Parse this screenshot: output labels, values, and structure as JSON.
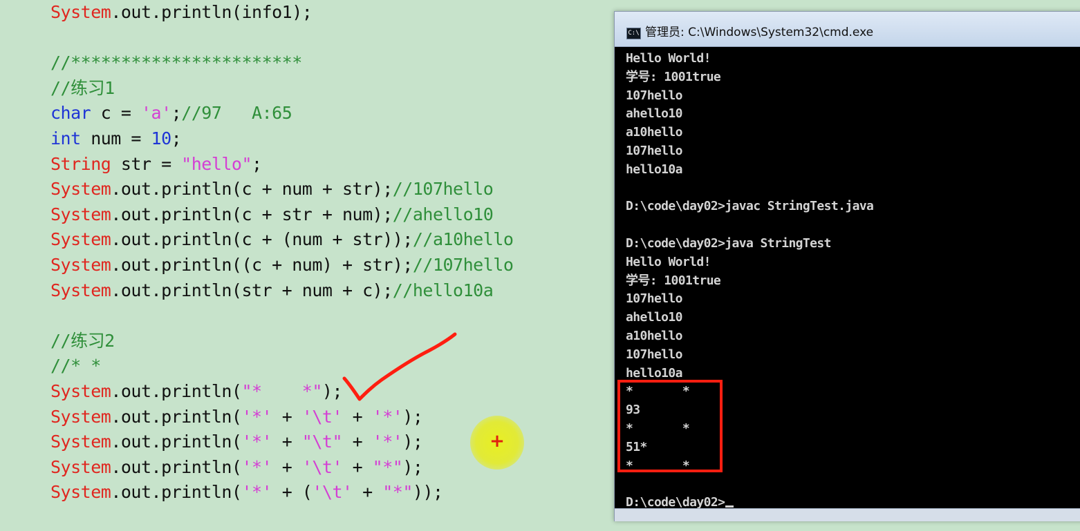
{
  "editor": {
    "lines": [
      [
        {
          "t": "System",
          "c": "class"
        },
        {
          "t": ".out.println(info1);",
          "c": "plain"
        }
      ],
      [],
      [
        {
          "t": "//***********************",
          "c": "cmt"
        }
      ],
      [
        {
          "t": "//练习1",
          "c": "cmt"
        }
      ],
      [
        {
          "t": "char",
          "c": "kw"
        },
        {
          "t": " c = ",
          "c": "plain"
        },
        {
          "t": "'a'",
          "c": "str"
        },
        {
          "t": ";",
          "c": "plain"
        },
        {
          "t": "//97   A:65",
          "c": "cmt"
        }
      ],
      [
        {
          "t": "int",
          "c": "kw"
        },
        {
          "t": " num = ",
          "c": "plain"
        },
        {
          "t": "10",
          "c": "num"
        },
        {
          "t": ";",
          "c": "plain"
        }
      ],
      [
        {
          "t": "String",
          "c": "class"
        },
        {
          "t": " str = ",
          "c": "plain"
        },
        {
          "t": "\"hello\"",
          "c": "str"
        },
        {
          "t": ";",
          "c": "plain"
        }
      ],
      [
        {
          "t": "System",
          "c": "class"
        },
        {
          "t": ".out.println(c + num + str);",
          "c": "plain"
        },
        {
          "t": "//107hello",
          "c": "cmt"
        }
      ],
      [
        {
          "t": "System",
          "c": "class"
        },
        {
          "t": ".out.println(c + str + num);",
          "c": "plain"
        },
        {
          "t": "//ahello10",
          "c": "cmt"
        }
      ],
      [
        {
          "t": "System",
          "c": "class"
        },
        {
          "t": ".out.println(c + (num + str));",
          "c": "plain"
        },
        {
          "t": "//a10hello",
          "c": "cmt"
        }
      ],
      [
        {
          "t": "System",
          "c": "class"
        },
        {
          "t": ".out.println((c + num) + str);",
          "c": "plain"
        },
        {
          "t": "//107hello",
          "c": "cmt"
        }
      ],
      [
        {
          "t": "System",
          "c": "class"
        },
        {
          "t": ".out.println(str + num + c);",
          "c": "plain"
        },
        {
          "t": "//hello10a",
          "c": "cmt"
        }
      ],
      [],
      [
        {
          "t": "//练习2",
          "c": "cmt"
        }
      ],
      [
        {
          "t": "//* *",
          "c": "cmt"
        }
      ],
      [
        {
          "t": "System",
          "c": "class"
        },
        {
          "t": ".out.println(",
          "c": "plain"
        },
        {
          "t": "\"*    *\"",
          "c": "str"
        },
        {
          "t": ");",
          "c": "plain"
        }
      ],
      [
        {
          "t": "System",
          "c": "class"
        },
        {
          "t": ".out.println(",
          "c": "plain"
        },
        {
          "t": "'*'",
          "c": "str"
        },
        {
          "t": " + ",
          "c": "plain"
        },
        {
          "t": "'\\t'",
          "c": "str"
        },
        {
          "t": " + ",
          "c": "plain"
        },
        {
          "t": "'*'",
          "c": "str"
        },
        {
          "t": ");",
          "c": "plain"
        }
      ],
      [
        {
          "t": "System",
          "c": "class"
        },
        {
          "t": ".out.println(",
          "c": "plain"
        },
        {
          "t": "'*'",
          "c": "str"
        },
        {
          "t": " + ",
          "c": "plain"
        },
        {
          "t": "\"\\t\"",
          "c": "str"
        },
        {
          "t": " + ",
          "c": "plain"
        },
        {
          "t": "'*'",
          "c": "str"
        },
        {
          "t": ");",
          "c": "plain"
        }
      ],
      [
        {
          "t": "System",
          "c": "class"
        },
        {
          "t": ".out.println(",
          "c": "plain"
        },
        {
          "t": "'*'",
          "c": "str"
        },
        {
          "t": " + ",
          "c": "plain"
        },
        {
          "t": "'\\t'",
          "c": "str"
        },
        {
          "t": " + ",
          "c": "plain"
        },
        {
          "t": "\"*\"",
          "c": "str"
        },
        {
          "t": ");",
          "c": "plain"
        }
      ],
      [
        {
          "t": "System",
          "c": "class"
        },
        {
          "t": ".out.println(",
          "c": "plain"
        },
        {
          "t": "'*'",
          "c": "str"
        },
        {
          "t": " + (",
          "c": "plain"
        },
        {
          "t": "'\\t'",
          "c": "str"
        },
        {
          "t": " + ",
          "c": "plain"
        },
        {
          "t": "\"*\"",
          "c": "str"
        },
        {
          "t": "));",
          "c": "plain"
        }
      ]
    ]
  },
  "colors": {
    "editor_bg": "#c7e3cb",
    "class": "#e0261f",
    "keyword": "#1f35d6",
    "comment": "#2f8f3a",
    "string": "#d43fd4",
    "annotation_red": "#ff1e10",
    "cursor_halo": "#ebf014"
  },
  "console": {
    "icon_label": "C:\\",
    "title": "管理员: C:\\Windows\\System32\\cmd.exe",
    "lines": [
      "Hello World!",
      "学号: 1001true",
      "107hello",
      "ahello10",
      "a10hello",
      "107hello",
      "hello10a",
      "",
      "D:\\code\\day02>javac StringTest.java",
      "",
      "D:\\code\\day02>java StringTest",
      "Hello World!",
      "学号: 1001true",
      "107hello",
      "ahello10",
      "a10hello",
      "107hello",
      "hello10a",
      "*       *",
      "93",
      "*       *",
      "51*",
      "*       *",
      "",
      "D:\\code\\day02>"
    ]
  },
  "annotations": {
    "cursor_symbol": "+"
  }
}
